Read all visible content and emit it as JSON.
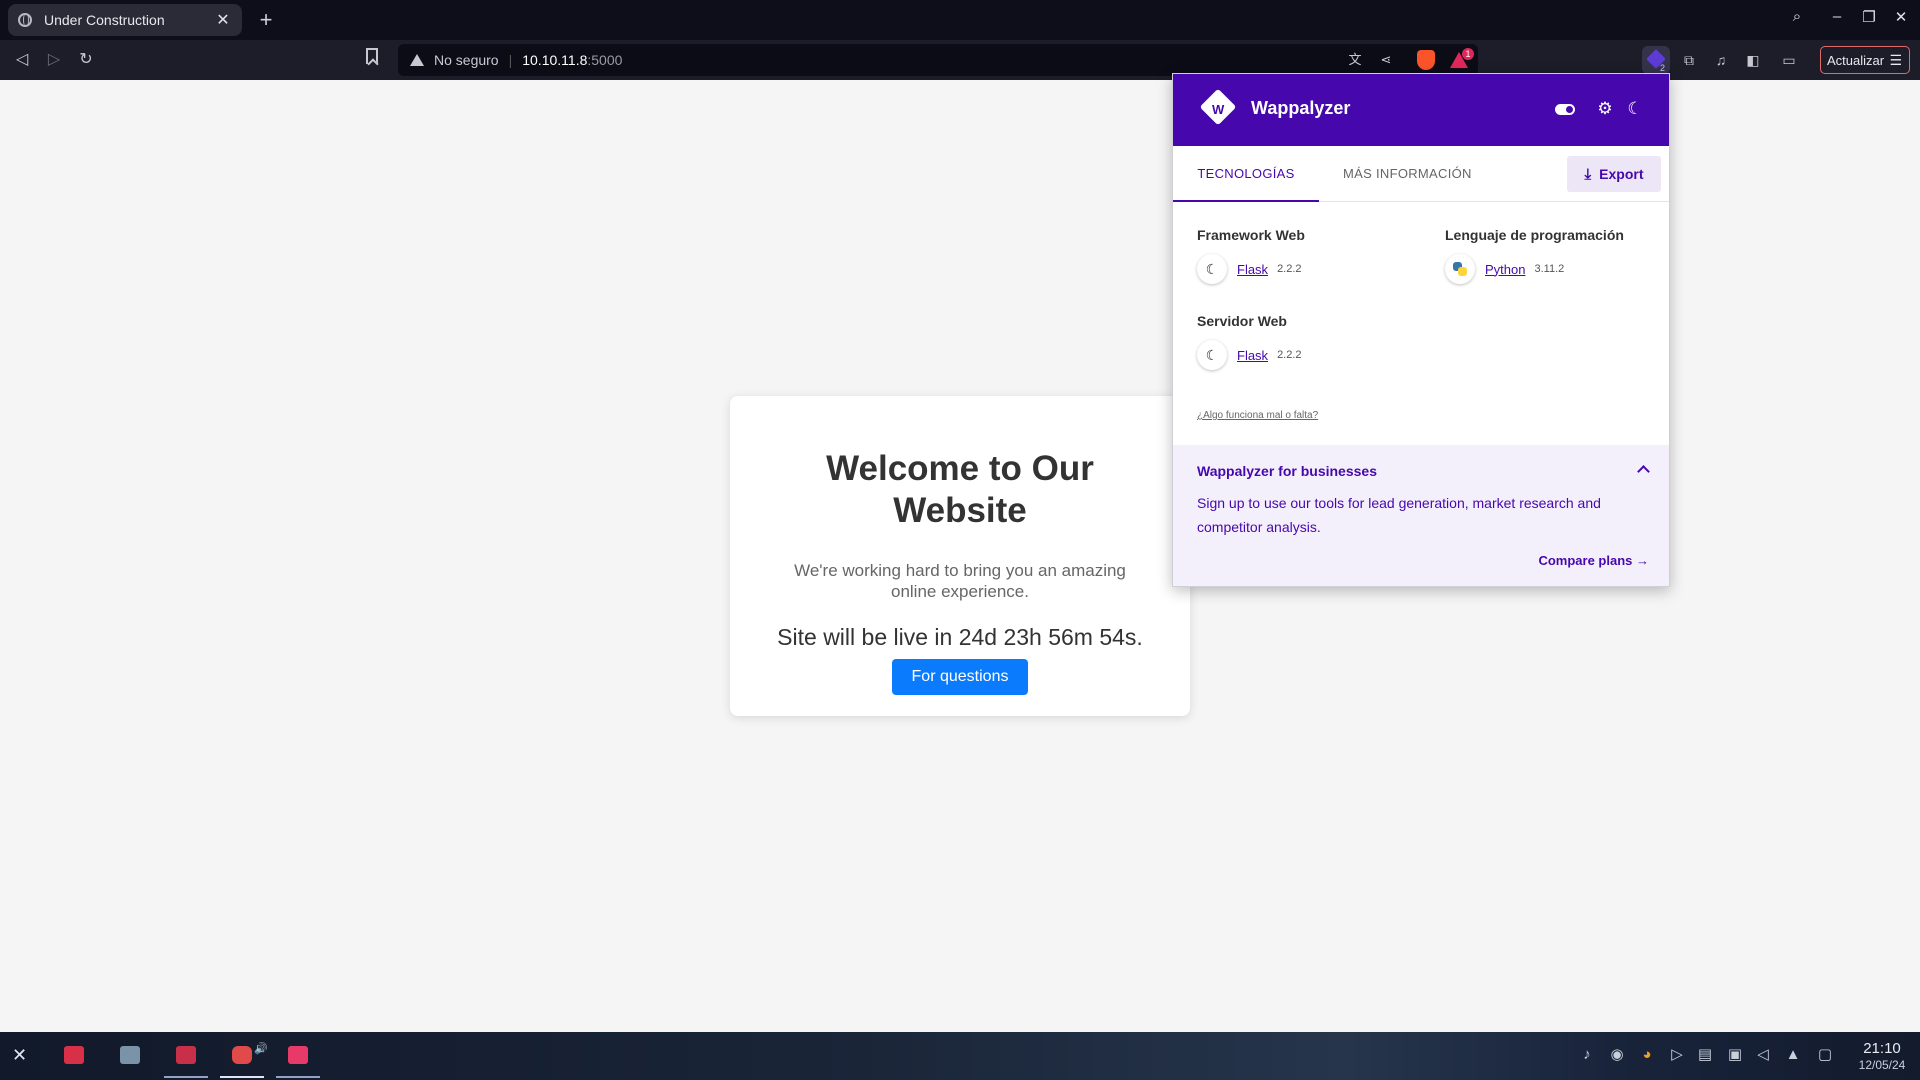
{
  "browser": {
    "tab_title": "Under Construction",
    "tab_close": "✕",
    "new_tab": "+",
    "security_label": "No seguro",
    "url_host": "10.10.11.8",
    "url_port": ":5000",
    "rewards_badge": "1",
    "wappalyzer_badge": "2",
    "update_label": "Actualizar"
  },
  "page": {
    "heading": "Welcome to Our Website",
    "lead": "We're working hard to bring you an amazing online experience.",
    "countdown": "Site will be live in 24d 23h 56m 54s.",
    "cta_label": "For questions"
  },
  "wappalyzer": {
    "brand": "Wappalyzer",
    "tabs": {
      "technologies": "TECNOLOGÍAS",
      "more_info": "MÁS INFORMACIÓN"
    },
    "export_label": "Export",
    "categories": [
      {
        "name": "Framework Web",
        "tech": {
          "name": "Flask",
          "version": "2.2.2"
        }
      },
      {
        "name": "Lenguaje de programación",
        "tech": {
          "name": "Python",
          "version": "3.11.2"
        }
      },
      {
        "name": "Servidor Web",
        "tech": {
          "name": "Flask",
          "version": "2.2.2"
        }
      }
    ],
    "report_link": "¿Algo funciona mal o falta?",
    "business": {
      "title": "Wappalyzer for businesses",
      "text": "Sign up to use our tools for lead generation, market research and competitor analysis.",
      "link": "Compare plans"
    }
  },
  "taskbar": {
    "time": "21:10",
    "date": "12/05/24"
  },
  "colors": {
    "wappalyzer_purple": "#4608ad",
    "cta_blue": "#0b7bfe",
    "tabbar_bg": "#0e0e1b",
    "toolbar_bg": "#1c1d29"
  }
}
